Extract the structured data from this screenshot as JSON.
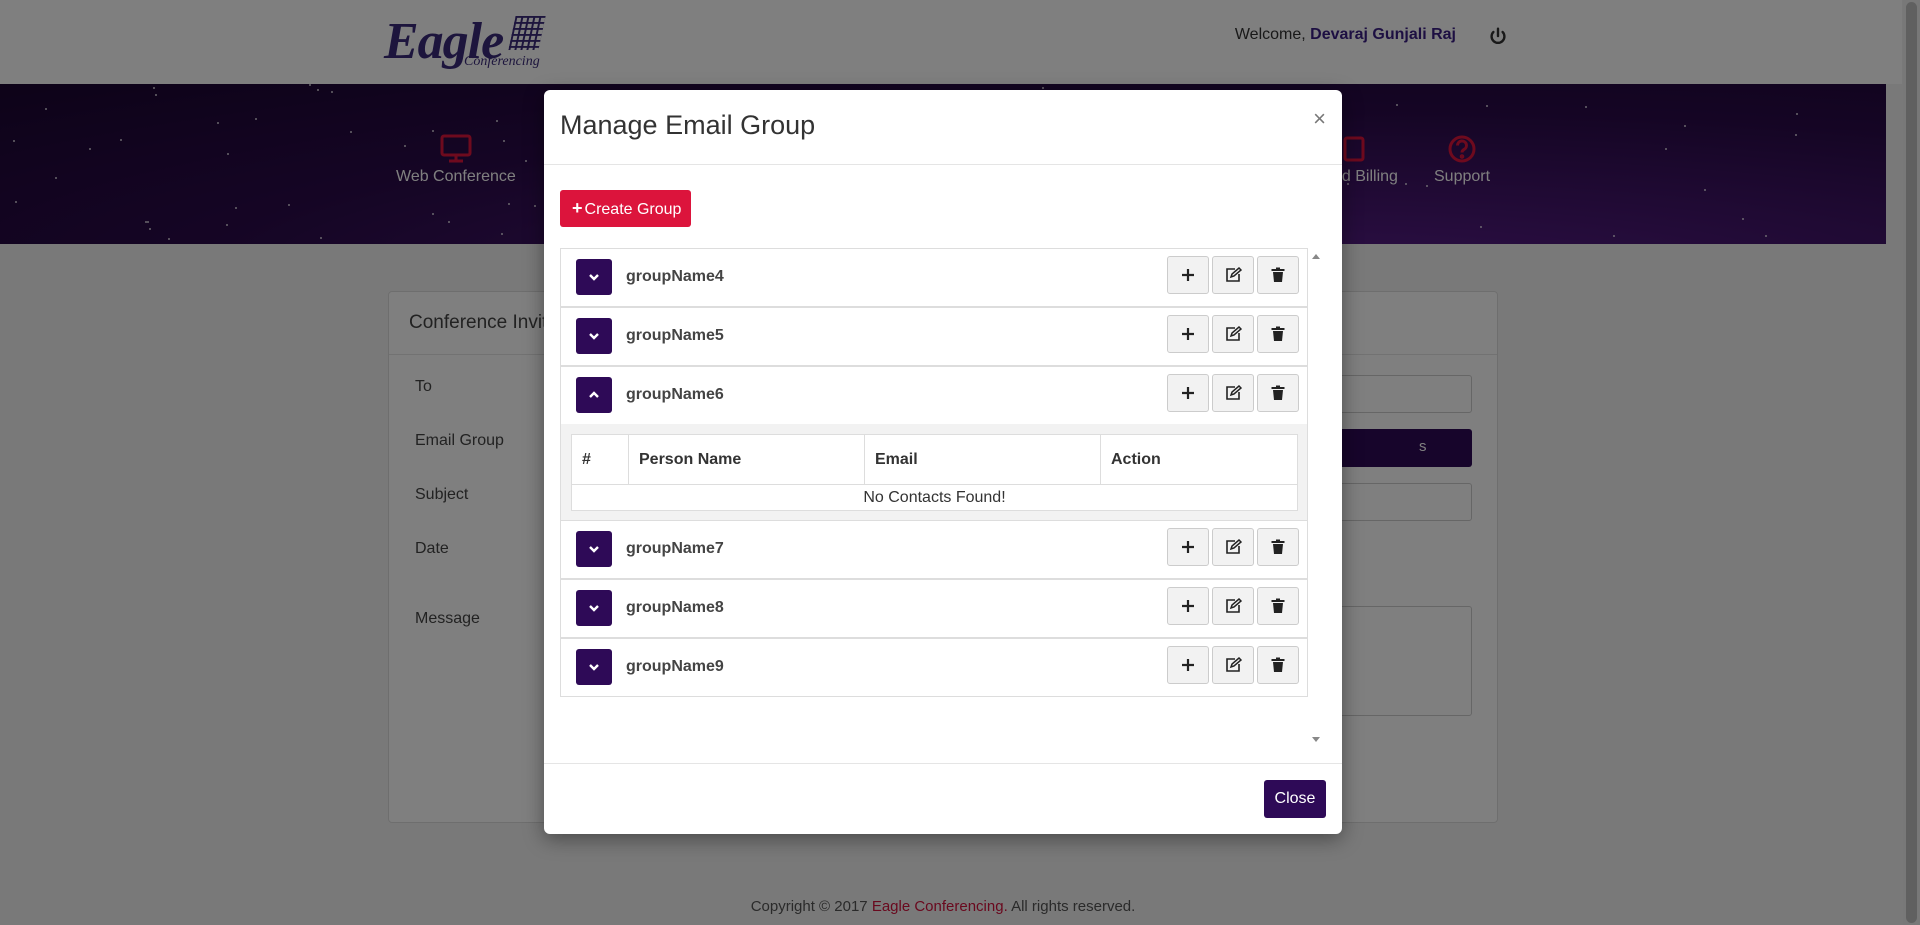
{
  "header": {
    "logo_word": "Eagle",
    "logo_sub": "Conferencing",
    "welcome_prefix": "Welcome,",
    "user_name": "Devaraj Gunjali Raj"
  },
  "nav": {
    "web_conference": "Web Conference",
    "billing": "Account and Billing",
    "billing_visible": "nd Billing",
    "support": "Support"
  },
  "form": {
    "card_title": "Conference Invit",
    "labels": {
      "to": "To",
      "email_group": "Email Group",
      "subject": "Subject",
      "date": "Date",
      "message": "Message"
    },
    "email_group_button_tail": "s"
  },
  "modal": {
    "title": "Manage Email Group",
    "close_x": "×",
    "create_group": "Create Group",
    "groups": [
      {
        "name": "groupName4",
        "expanded": false
      },
      {
        "name": "groupName5",
        "expanded": false
      },
      {
        "name": "groupName6",
        "expanded": true
      },
      {
        "name": "groupName7",
        "expanded": false
      },
      {
        "name": "groupName8",
        "expanded": false
      },
      {
        "name": "groupName9",
        "expanded": false
      }
    ],
    "contacts_table": {
      "headers": [
        "#",
        "Person Name",
        "Email",
        "Action"
      ],
      "empty_message": "No Contacts Found!"
    },
    "close_button": "Close"
  },
  "footer": {
    "prefix": "Copyright © 2017",
    "brand": "Eagle Conferencing.",
    "suffix": "All rights reserved."
  },
  "colors": {
    "primary": "#2e0a57",
    "accent": "#dc143c"
  }
}
